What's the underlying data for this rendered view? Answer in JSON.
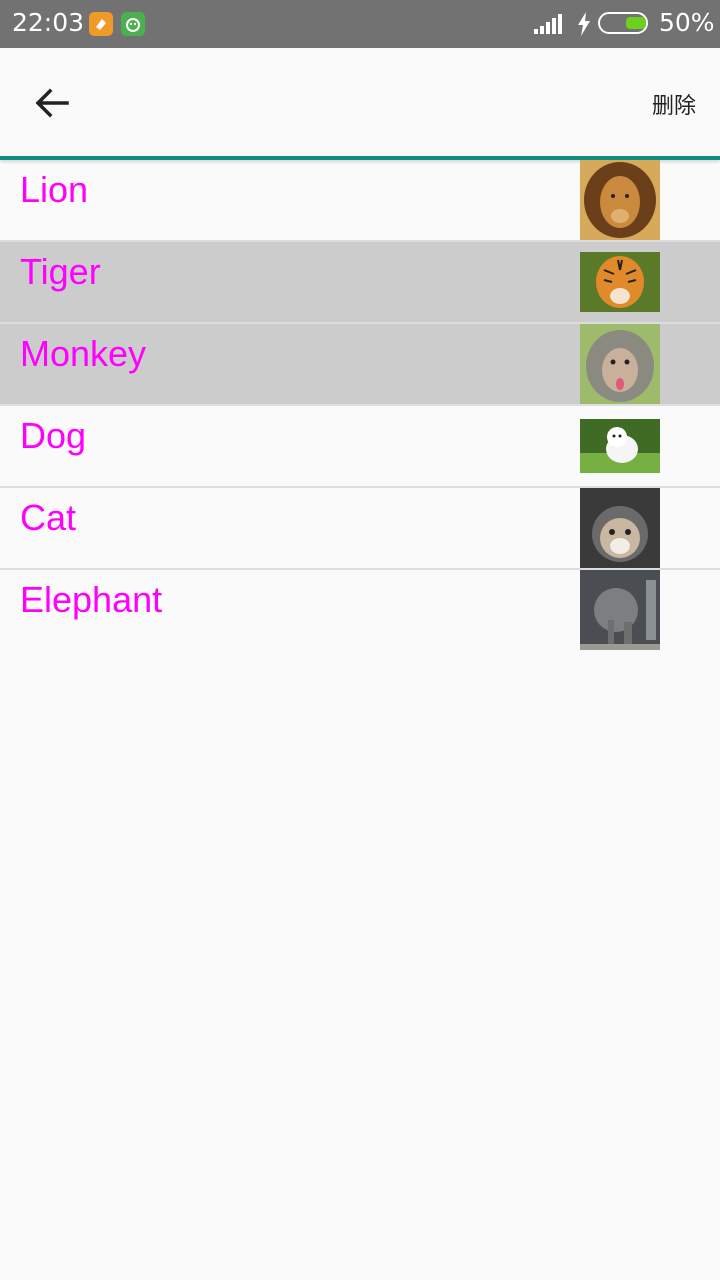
{
  "status_bar": {
    "time": "22:03",
    "battery": "50%",
    "battery_level": 0.5,
    "icons": [
      "app-orange-icon",
      "app-green-icon",
      "signal-icon",
      "charging-bolt-icon",
      "battery-icon"
    ]
  },
  "toolbar": {
    "back_icon": "arrow-left-icon",
    "delete_label": "删除"
  },
  "animals": [
    {
      "label": "Lion",
      "selected": false,
      "image": "lion-photo"
    },
    {
      "label": "Tiger",
      "selected": true,
      "image": "tiger-photo"
    },
    {
      "label": "Monkey",
      "selected": true,
      "image": "monkey-photo"
    },
    {
      "label": "Dog",
      "selected": false,
      "image": "dog-photo"
    },
    {
      "label": "Cat",
      "selected": false,
      "image": "cat-photo"
    },
    {
      "label": "Elephant",
      "selected": false,
      "image": "elephant-photo"
    }
  ],
  "colors": {
    "accent": "#128c7e",
    "label": "#ff00ff",
    "selected_row": "#cccccc"
  }
}
